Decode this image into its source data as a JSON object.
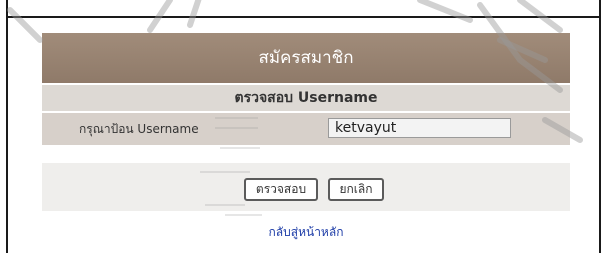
{
  "form": {
    "title": "สมัครสมาชิก",
    "subtitle": "ตรวจสอบ Username",
    "username_label": "กรุณาป้อน Username",
    "username_value": "ketvayut",
    "check_button": "ตรวจสอบ",
    "cancel_button": "ยกเลิก",
    "home_link": "กลับสู่หน้าหลัก"
  },
  "colors": {
    "header_bg": "#978270",
    "row_bg": "#d7d0ca",
    "link": "#1f3ea8"
  }
}
